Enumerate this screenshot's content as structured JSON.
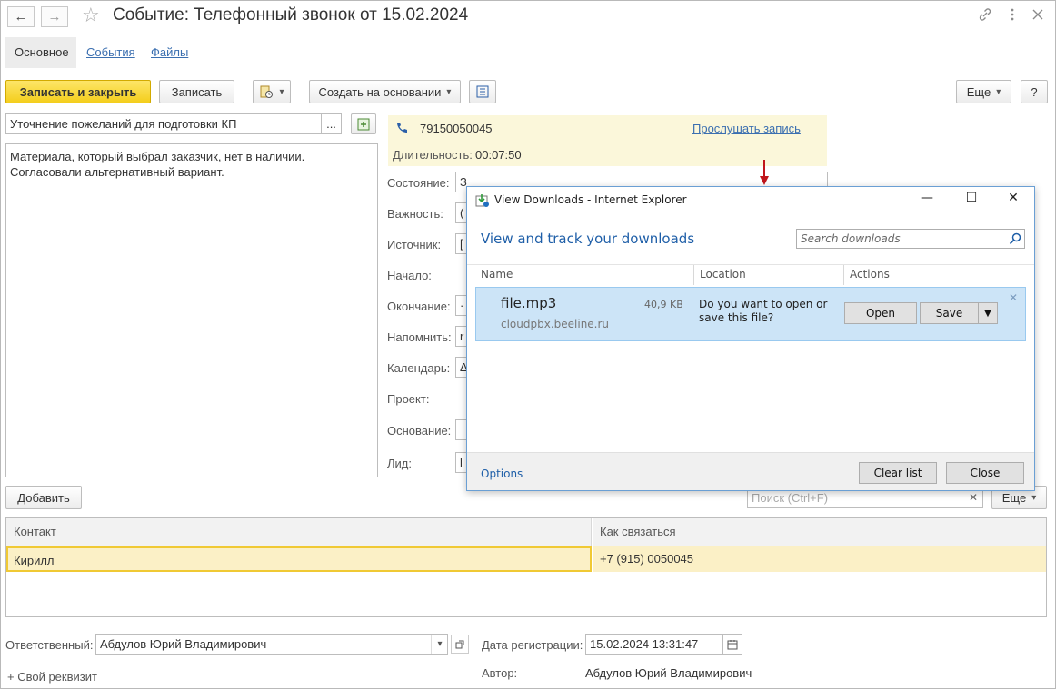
{
  "window": {
    "title": "Событие: Телефонный звонок от 15.02.2024",
    "back_icon": "←",
    "forward_icon": "→",
    "star_icon": "☆"
  },
  "tabs": [
    {
      "label": "Основное"
    },
    {
      "label": "События"
    },
    {
      "label": "Файлы"
    }
  ],
  "toolbar": {
    "save_close": "Записать и закрыть",
    "save": "Записать",
    "create_based": "Создать на основании",
    "more": "Еще",
    "help": "?"
  },
  "subject": {
    "value": "Уточнение пожеланий для подготовки КП",
    "ellipsis": "..."
  },
  "description": "Материала, который выбрал заказчик, нет в наличии. Согласовали альтернативный вариант.",
  "call": {
    "phone": "79150050045",
    "listen_link": "Прослушать запись",
    "duration_label": "Длительность:",
    "duration_value": "00:07:50"
  },
  "fields": [
    {
      "label": "Состояние:",
      "value": "З"
    },
    {
      "label": "Важность:",
      "value": "("
    },
    {
      "label": "Источник:",
      "value": "["
    },
    {
      "label": "Начало:",
      "value": ""
    },
    {
      "label": "Окончание:",
      "value": "·"
    },
    {
      "label": "Напомнить:",
      "value": "r"
    },
    {
      "label": "Календарь:",
      "value": "Δ"
    },
    {
      "label": "Проект:",
      "value": ""
    },
    {
      "label": "Основание:",
      "value": ""
    },
    {
      "label": "Лид:",
      "value": "l"
    }
  ],
  "contacts": {
    "add_button": "Добавить",
    "search_placeholder": "Поиск (Ctrl+F)",
    "more": "Еще",
    "headers": [
      "Контакт",
      "Как связаться"
    ],
    "rows": [
      {
        "contact": "Кирилл",
        "how": "+7 (915) 0050045"
      }
    ]
  },
  "footer": {
    "responsible_label": "Ответственный:",
    "responsible_value": "Абдулов Юрий Владимирович",
    "reg_date_label": "Дата регистрации:",
    "reg_date_value": "15.02.2024 13:31:47",
    "custom_prop": "+ Свой реквизит",
    "author_label": "Автор:",
    "author_value": "Абдулов Юрий Владимирович"
  },
  "ie_dialog": {
    "title": "View Downloads - Internet Explorer",
    "heading": "View and track your downloads",
    "search_placeholder": "Search downloads",
    "col_name": "Name",
    "col_location": "Location",
    "col_actions": "Actions",
    "file_name": "file.mp3",
    "file_size": "40,9 KB",
    "file_source": "cloudpbx.beeline.ru",
    "question": "Do you want to open or save this file?",
    "open": "Open",
    "save": "Save",
    "options": "Options",
    "clear_list": "Clear list",
    "close": "Close",
    "minimize_icon": "—",
    "maximize_icon": "☐",
    "close_icon": "✕"
  },
  "colors": {
    "accent_yellow": "#f4ce1c",
    "link_blue": "#3b6fb0",
    "ie_blue": "#1f5fa8",
    "selection": "#cce4f7",
    "row_highlight": "#fbf0c6",
    "arrow_red": "#c0161c"
  }
}
